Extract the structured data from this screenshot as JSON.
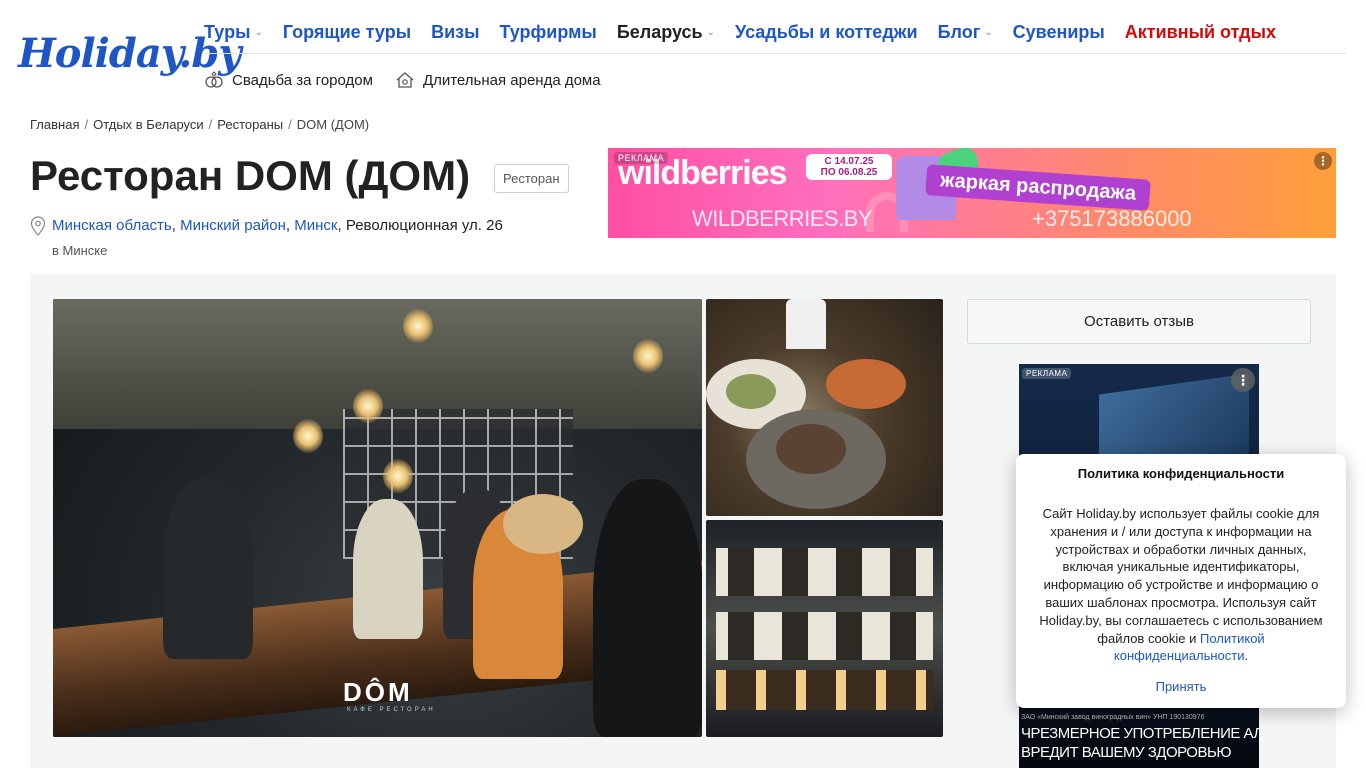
{
  "logo": {
    "text": "Holiday.by"
  },
  "nav": {
    "items": [
      {
        "label": "Туры",
        "has_dropdown": true,
        "style": "blue"
      },
      {
        "label": "Горящие туры",
        "has_dropdown": false,
        "style": "blue"
      },
      {
        "label": "Визы",
        "has_dropdown": false,
        "style": "blue"
      },
      {
        "label": "Турфирмы",
        "has_dropdown": false,
        "style": "blue"
      },
      {
        "label": "Беларусь",
        "has_dropdown": true,
        "style": "dark"
      },
      {
        "label": "Усадьбы и коттеджи",
        "has_dropdown": false,
        "style": "blue"
      },
      {
        "label": "Блог",
        "has_dropdown": true,
        "style": "blue"
      },
      {
        "label": "Сувениры",
        "has_dropdown": false,
        "style": "blue"
      },
      {
        "label": "Активный отдых",
        "has_dropdown": false,
        "style": "red"
      }
    ],
    "chevron": "⌄"
  },
  "subnav": {
    "items": [
      {
        "label": "Свадьба за городом",
        "icon": "rings-icon"
      },
      {
        "label": "Длительная аренда дома",
        "icon": "house-icon"
      }
    ]
  },
  "breadcrumb": {
    "items": [
      "Главная",
      "Отдых в Беларуси",
      "Рестораны",
      "DOM (ДОМ)"
    ],
    "separator": "/"
  },
  "page": {
    "title": "Ресторан DOM (ДОМ)",
    "type_badge": "Ресторан",
    "address": {
      "region": "Минская область",
      "district": "Минский район",
      "city": "Минск",
      "street": "Революционная ул. 26",
      "note": "в Минске"
    }
  },
  "ad_banner": {
    "label": "РЕКЛАМА",
    "brand": "wildberries",
    "dates": [
      "С 14.07.25",
      "ПО 06.08.25"
    ],
    "slogan": "жаркая распродажа",
    "site": "WILDBERRIES.BY",
    "phone": "+375173886000",
    "menu_glyph": "⋮"
  },
  "gallery": {
    "main_logo": "DÔM",
    "main_logo_sub": "КАФЕ РЕСТОРАН"
  },
  "sidebar": {
    "review_button": "Оставить отзыв",
    "side_ad": {
      "label": "РЕКЛАМА",
      "menu_glyph": "⋮",
      "disclaimer": "ЗАО «Минский завод виноградных вин» УНП 190130976",
      "warning_line1": "ЧРЕЗМЕРНОЕ УПОТРЕБЛЕНИЕ АЛКОГОЛЯ",
      "warning_line2": "ВРЕДИТ ВАШЕМУ ЗДОРОВЬЮ"
    }
  },
  "cookie_modal": {
    "title": "Политика конфиденциальности",
    "body": "Сайт Holiday.by использует файлы cookie для хранения и / или доступа к информации на устройствах и обработки личных данных, включая уникальные идентификаторы, информацию об устройстве и информацию о ваших шаблонах просмотра. Используя сайт Holiday.by, вы соглашаетесь с использованием файлов cookie и ",
    "link": "Политикой конфиденциальности",
    "body_end": ".",
    "accept": "Принять"
  },
  "colors": {
    "brand_blue": "#1e56c5",
    "accent_red": "#d10a0a",
    "panel_bg": "#f4f5f5"
  }
}
